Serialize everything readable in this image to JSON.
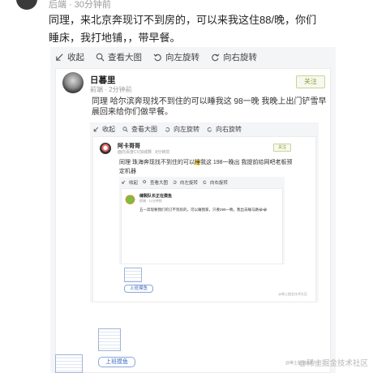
{
  "top": {
    "meta_label": "后端",
    "time": "30分钟前"
  },
  "post": {
    "text": "同理，来北京奔现订不到房的，可以来我这住88/晚，你们睡床，我打地铺，，带早餐。"
  },
  "toolbar": {
    "collapse": "收起",
    "view_large": "查看大图",
    "rotate_left": "向左旋转",
    "rotate_right": "向右旋转"
  },
  "repost1": {
    "name": "日暮里",
    "role": "前端",
    "time": "2分钟前",
    "follow": "关注",
    "text": "同理 哈尔滨奔现找不到住的可以睡我这 98一晚 我晚上出门铲雪早晨回来给你们做早餐。"
  },
  "repost2": {
    "name": "阿卡哥哥",
    "meta": "面向百度CV加城狮",
    "time": "8分钟前",
    "follow": "关注",
    "text_before": "同理 珠海奔现找不到住的可以",
    "text_highlight": "睡",
    "text_after": "我这 198一晚出 我提前给网吧老板预定机器"
  },
  "repost3": {
    "name": "缝製队长正在摸鱼",
    "role": "前端",
    "time": "11分钟前",
    "text": "五一奔现要我们的订不到房的，可以睡我家，只要299一晚，我出去睡马路😂😂"
  },
  "work_tag": "上班摸鱼",
  "footer_small": "@稀土掘金技术社区",
  "watermark": "@稀土掘金技术社区"
}
